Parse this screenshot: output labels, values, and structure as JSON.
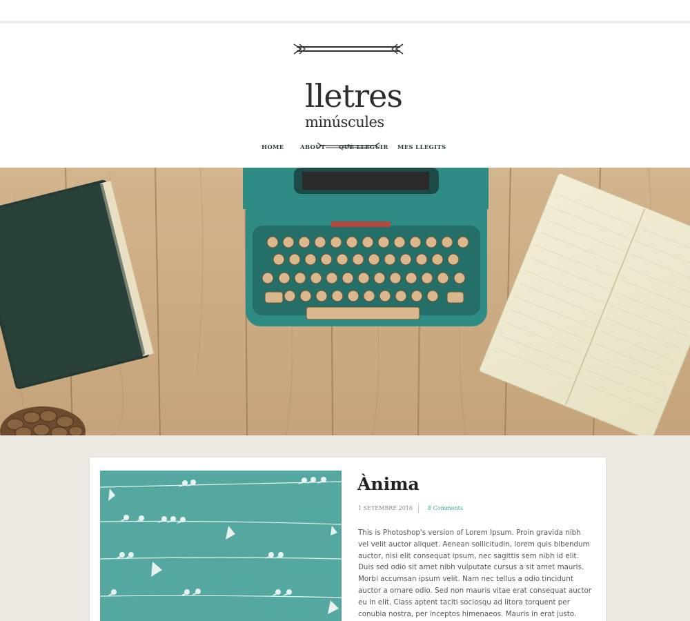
{
  "site": {
    "title_line1": "lletres",
    "title_line2": "minúscules"
  },
  "nav": {
    "items": [
      "HOME",
      "ABOUT",
      "QUÈ LLEGUIR",
      "MES LLEGITS"
    ]
  },
  "post": {
    "title": "Ànima",
    "date": "1 SETEMBRE 2016",
    "comments": "8 Comments",
    "excerpt": "This is Photoshop's version  of Lorem Ipsum. Proin gravida nibh vel velit auctor aliquet. Aenean sollicitudin, lorem quis bibendum auctor, nisi elit consequat ipsum, nec sagittis sem nibh id elit. Duis sed odio sit amet nibh vulputate cursus a sit amet mauris. Morbi accumsan ipsum velit. Nam nec tellus a odio tincidunt auctor a ornare odio. Sed non  mauris vitae erat consequat auctor eu in elit. Class aptent taciti sociosqu ad litora torquent per conubia nostra, per inceptos himenaeos. Mauris in erat justo."
  },
  "colors": {
    "accent": "#3aa8a0",
    "typewriter": "#2f8c84",
    "background": "#ece8e2",
    "thumb": "#4fa39a"
  },
  "icons": {
    "hero": "typewriter-desk-photo",
    "thumb": "birds-on-wires-illustration"
  }
}
